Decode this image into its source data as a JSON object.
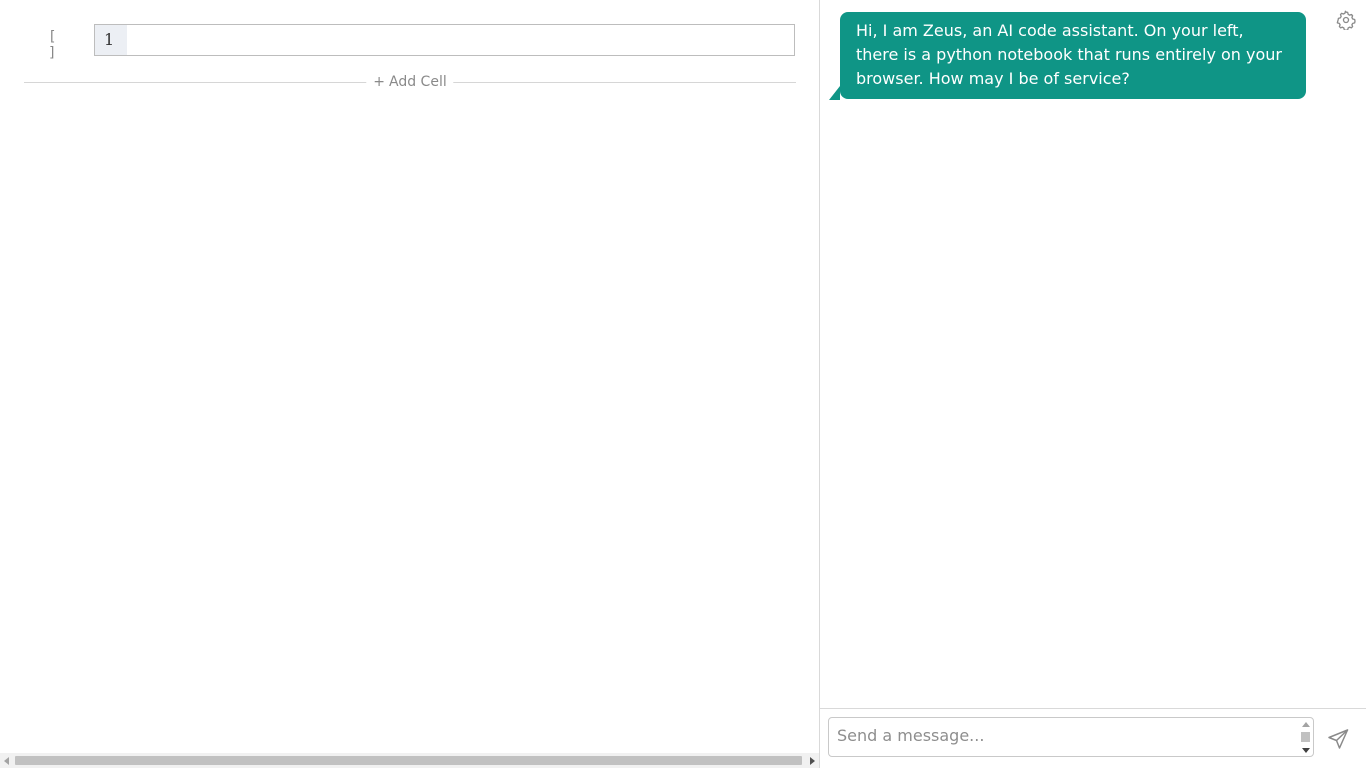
{
  "notebook": {
    "cells": [
      {
        "execution_count_label": "[ ]",
        "line_number": "1",
        "code": ""
      }
    ],
    "add_cell": {
      "icon": "plus-icon",
      "plus_glyph": "+",
      "label": "Add Cell"
    }
  },
  "chat": {
    "settings_icon": "gear-icon",
    "messages": [
      {
        "role": "assistant",
        "text": "Hi, I am Zeus, an AI code assistant. On your left, there is a python notebook that runs entirely on your browser. How may I be of service?"
      }
    ],
    "composer": {
      "placeholder": "Send a message...",
      "value": "",
      "send_icon": "send-icon"
    },
    "accent_color": "#0f9586"
  }
}
